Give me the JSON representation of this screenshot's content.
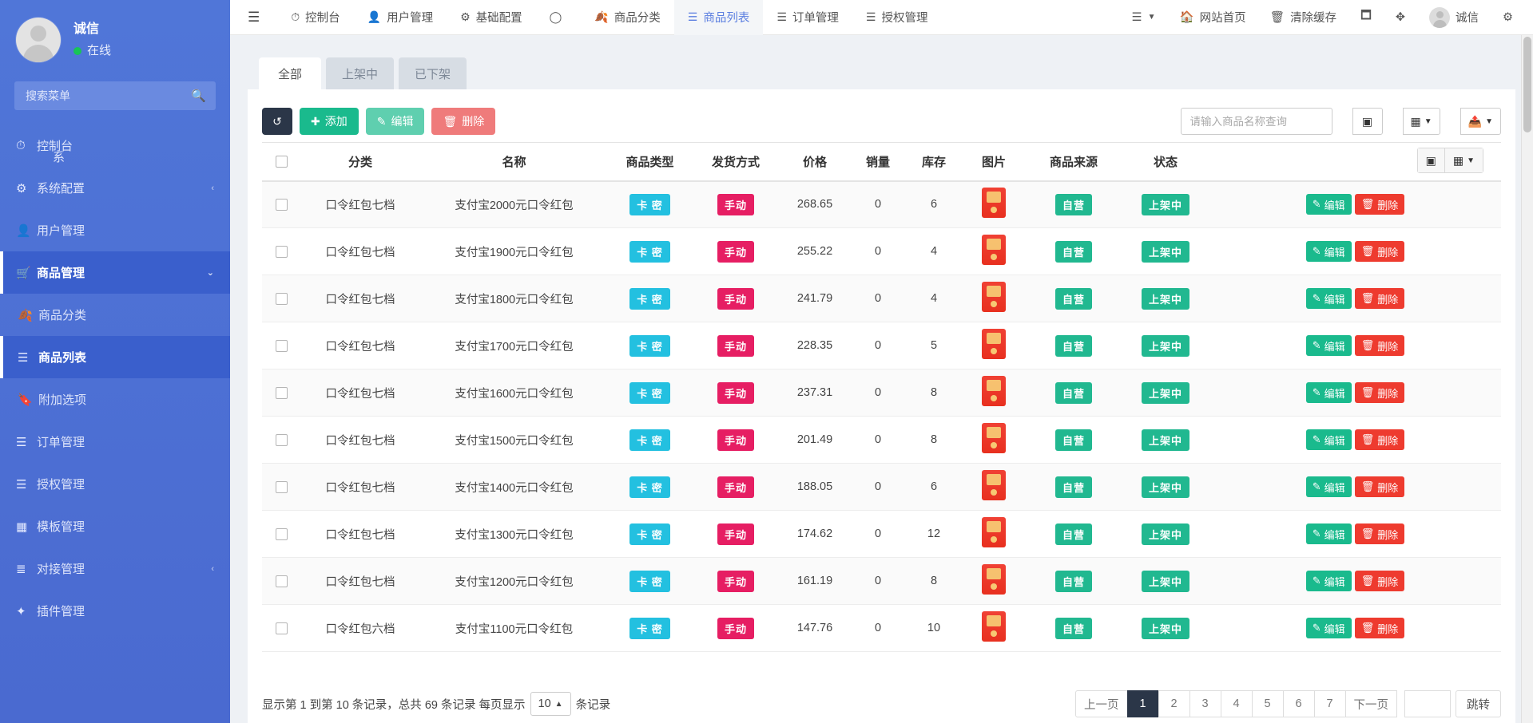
{
  "sidebar": {
    "user": {
      "name": "诚信",
      "status": "在线",
      "status_color": "#18c457"
    },
    "search_placeholder": "搜索菜单",
    "search_icon": "search-icon",
    "items": [
      {
        "label": "控制台",
        "icon": "dashboard-icon",
        "active": false,
        "sub_label": "系"
      },
      {
        "label": "系统配置",
        "icon": "gear-icon",
        "active": false,
        "caret": "‹"
      },
      {
        "label": "用户管理",
        "icon": "user-icon",
        "active": false
      },
      {
        "label": "商品管理",
        "icon": "cart-icon",
        "active": true,
        "caret": "⌄"
      },
      {
        "label": "商品分类",
        "icon": "leaf-icon",
        "active": false
      },
      {
        "label": "商品列表",
        "icon": "list-icon",
        "active": true
      },
      {
        "label": "附加选项",
        "icon": "bookmark-icon",
        "active": false
      },
      {
        "label": "订单管理",
        "icon": "menu-icon",
        "active": false
      },
      {
        "label": "授权管理",
        "icon": "menu-icon",
        "active": false
      },
      {
        "label": "模板管理",
        "icon": "window-icon",
        "active": false
      },
      {
        "label": "对接管理",
        "icon": "sliders-icon",
        "active": false,
        "caret": "‹"
      },
      {
        "label": "插件管理",
        "icon": "feather-icon",
        "active": false
      }
    ]
  },
  "topbar": {
    "burger_icon": "hamburger-icon",
    "nav": [
      {
        "label": "控制台",
        "icon": "dashboard-icon",
        "active": false
      },
      {
        "label": "用户管理",
        "icon": "user-icon",
        "active": false
      },
      {
        "label": "基础配置",
        "icon": "gear-icon",
        "active": false
      },
      {
        "label": "",
        "icon": "circle-icon",
        "active": false
      },
      {
        "label": "商品分类",
        "icon": "leaf-icon",
        "active": false
      },
      {
        "label": "商品列表",
        "icon": "list-icon",
        "active": true
      },
      {
        "label": "订单管理",
        "icon": "menu-icon",
        "active": false
      },
      {
        "label": "授权管理",
        "icon": "menu-icon",
        "active": false
      }
    ],
    "right": [
      {
        "label": "",
        "icon": "stack-dropdown-icon"
      },
      {
        "label": "网站首页",
        "icon": "home-icon"
      },
      {
        "label": "清除缓存",
        "icon": "trash-icon"
      },
      {
        "label": "",
        "icon": "window-restore-icon"
      },
      {
        "label": "",
        "icon": "fullscreen-icon"
      },
      {
        "label": "诚信",
        "icon": "avatar-icon"
      },
      {
        "label": "",
        "icon": "cogs-icon"
      }
    ]
  },
  "tabs": [
    {
      "label": "全部",
      "active": true
    },
    {
      "label": "上架中",
      "active": false
    },
    {
      "label": "已下架",
      "active": false
    }
  ],
  "toolbar": {
    "refresh_label": "",
    "refresh_icon": "refresh-icon",
    "add_label": "添加",
    "add_icon": "plus-icon",
    "edit_label": "编辑",
    "edit_icon": "pencil-icon",
    "delete_label": "删除",
    "delete_icon": "trash-icon",
    "search_placeholder": "请输入商品名称查询",
    "icon_buttons": [
      {
        "icon": "list-view-icon",
        "caret": false
      },
      {
        "icon": "grid-columns-icon",
        "caret": true
      },
      {
        "icon": "export-icon",
        "caret": true
      }
    ]
  },
  "table": {
    "columns": [
      "",
      "分类",
      "名称",
      "商品类型",
      "发货方式",
      "价格",
      "销量",
      "库存",
      "图片",
      "商品来源",
      "状态",
      ""
    ],
    "header_float_buttons": [
      {
        "icon": "list-view-icon",
        "caret": false
      },
      {
        "icon": "grid-columns-icon",
        "caret": true
      }
    ],
    "row_actions": {
      "edit_label": "编辑",
      "edit_icon": "pencil-icon",
      "delete_label": "删除",
      "delete_icon": "trash-icon"
    },
    "rows": [
      {
        "category": "口令红包七档",
        "name": "支付宝2000元口令红包",
        "type": "卡 密",
        "ship": "手动",
        "price": "268.65",
        "sales": "0",
        "stock": "6",
        "image": "redpacket-thumb",
        "source": "自营",
        "status": "上架中"
      },
      {
        "category": "口令红包七档",
        "name": "支付宝1900元口令红包",
        "type": "卡 密",
        "ship": "手动",
        "price": "255.22",
        "sales": "0",
        "stock": "4",
        "image": "redpacket-thumb",
        "source": "自营",
        "status": "上架中"
      },
      {
        "category": "口令红包七档",
        "name": "支付宝1800元口令红包",
        "type": "卡 密",
        "ship": "手动",
        "price": "241.79",
        "sales": "0",
        "stock": "4",
        "image": "redpacket-thumb",
        "source": "自营",
        "status": "上架中"
      },
      {
        "category": "口令红包七档",
        "name": "支付宝1700元口令红包",
        "type": "卡 密",
        "ship": "手动",
        "price": "228.35",
        "sales": "0",
        "stock": "5",
        "image": "redpacket-thumb",
        "source": "自营",
        "status": "上架中"
      },
      {
        "category": "口令红包七档",
        "name": "支付宝1600元口令红包",
        "type": "卡 密",
        "ship": "手动",
        "price": "237.31",
        "sales": "0",
        "stock": "8",
        "image": "redpacket-thumb",
        "source": "自营",
        "status": "上架中"
      },
      {
        "category": "口令红包七档",
        "name": "支付宝1500元口令红包",
        "type": "卡 密",
        "ship": "手动",
        "price": "201.49",
        "sales": "0",
        "stock": "8",
        "image": "redpacket-thumb",
        "source": "自营",
        "status": "上架中"
      },
      {
        "category": "口令红包七档",
        "name": "支付宝1400元口令红包",
        "type": "卡 密",
        "ship": "手动",
        "price": "188.05",
        "sales": "0",
        "stock": "6",
        "image": "redpacket-thumb",
        "source": "自营",
        "status": "上架中"
      },
      {
        "category": "口令红包七档",
        "name": "支付宝1300元口令红包",
        "type": "卡 密",
        "ship": "手动",
        "price": "174.62",
        "sales": "0",
        "stock": "12",
        "image": "redpacket-thumb",
        "source": "自营",
        "status": "上架中"
      },
      {
        "category": "口令红包七档",
        "name": "支付宝1200元口令红包",
        "type": "卡 密",
        "ship": "手动",
        "price": "161.19",
        "sales": "0",
        "stock": "8",
        "image": "redpacket-thumb",
        "source": "自营",
        "status": "上架中"
      },
      {
        "category": "口令红包六档",
        "name": "支付宝1100元口令红包",
        "type": "卡 密",
        "ship": "手动",
        "price": "147.76",
        "sales": "0",
        "stock": "10",
        "image": "redpacket-thumb",
        "source": "自营",
        "status": "上架中"
      }
    ]
  },
  "footer": {
    "summary_prefix": "显示第 1 到第 10 条记录，总共 69 条记录 每页显示",
    "page_size": "10",
    "page_size_caret": "▲",
    "summary_suffix": "条记录",
    "prev_label": "上一页",
    "next_label": "下一页",
    "pages": [
      "1",
      "2",
      "3",
      "4",
      "5",
      "6",
      "7"
    ],
    "active_page": "1",
    "jump_label": "跳转",
    "jump_value": ""
  }
}
